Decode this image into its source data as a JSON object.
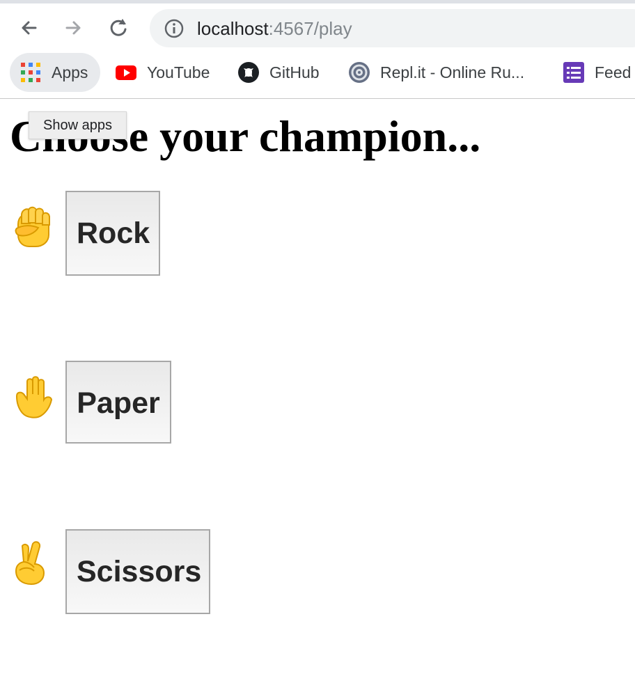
{
  "browser": {
    "url_host": "localhost",
    "url_path": ":4567/play",
    "icons": {
      "back": "back-arrow-icon",
      "forward": "forward-arrow-icon",
      "reload": "reload-icon",
      "site_info": "info-icon"
    },
    "bookmarks": [
      {
        "label": "Apps",
        "icon": "apps-grid-icon"
      },
      {
        "label": "YouTube",
        "icon": "youtube-icon"
      },
      {
        "label": "GitHub",
        "icon": "github-icon"
      },
      {
        "label": "Repl.it - Online Ru...",
        "icon": "replit-icon"
      },
      {
        "label": "Feed",
        "icon": "feed-icon"
      }
    ],
    "tooltip": "Show apps"
  },
  "page": {
    "title": "Choose your champion...",
    "choices": [
      {
        "label": "Rock",
        "icon": "raised-fist-icon"
      },
      {
        "label": "Paper",
        "icon": "raised-hand-icon"
      },
      {
        "label": "Scissors",
        "icon": "victory-hand-icon"
      }
    ]
  },
  "colors": {
    "youtube_red": "#FF0000",
    "feed_purple": "#673AB7",
    "emoji_yellow": "#FFCC33"
  }
}
